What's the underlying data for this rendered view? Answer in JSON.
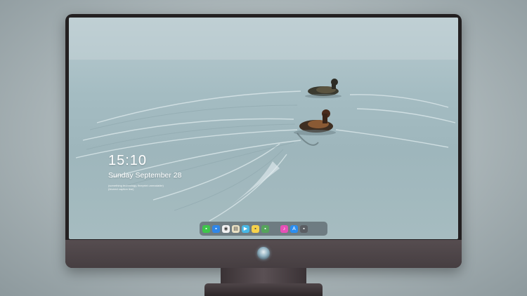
{
  "lock_screen": {
    "time": "15:10",
    "date": "Sunday September 28",
    "note_line1": "(something technology, fineprint unreadable)",
    "note_line2": "(blurred caption line)"
  },
  "dock": {
    "apps": [
      {
        "name": "messages-icon",
        "color": "#3ec64a",
        "glyph": "▪"
      },
      {
        "name": "finder-icon",
        "color": "#2f86e8",
        "glyph": "▪"
      },
      {
        "name": "compass-icon",
        "color": "#f2f2f2",
        "glyph": "◉"
      },
      {
        "name": "notes-icon",
        "color": "#e9e1c4",
        "glyph": "▤"
      },
      {
        "name": "media-icon",
        "color": "#47b8e6",
        "glyph": "▶"
      },
      {
        "name": "stickies-icon",
        "color": "#f6d24a",
        "glyph": "▪"
      },
      {
        "name": "photos-icon",
        "color": "#55a45b",
        "glyph": "▪"
      },
      {
        "name": "music-icon",
        "color": "#e64fb6",
        "glyph": "♪"
      },
      {
        "name": "appstore-icon",
        "color": "#2b8ef0",
        "glyph": "A"
      },
      {
        "name": "camera-icon",
        "color": "#5a5e63",
        "glyph": "▪"
      }
    ]
  }
}
